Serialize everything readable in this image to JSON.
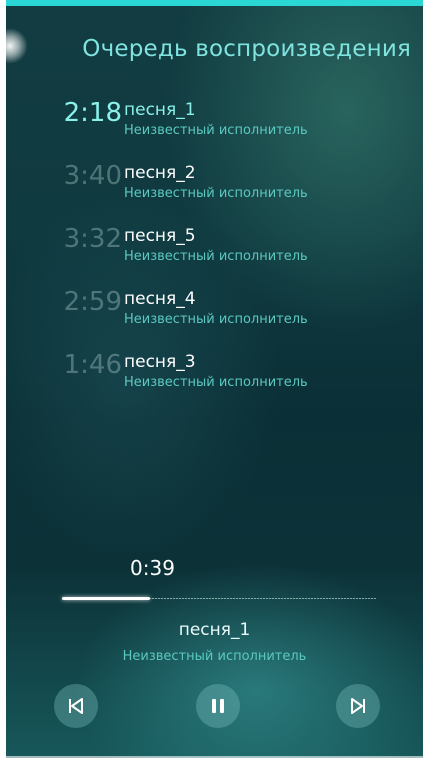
{
  "header": {
    "title": "Очередь воспроизведения"
  },
  "queue": [
    {
      "duration": "2:18",
      "title": "песня_1",
      "artist": "Неизвестный исполнитель",
      "active": true
    },
    {
      "duration": "3:40",
      "title": "песня_2",
      "artist": "Неизвестный исполнитель",
      "active": false
    },
    {
      "duration": "3:32",
      "title": "песня_5",
      "artist": "Неизвестный исполнитель",
      "active": false
    },
    {
      "duration": "2:59",
      "title": "песня_4",
      "artist": "Неизвестный исполнитель",
      "active": false
    },
    {
      "duration": "1:46",
      "title": "песня_3",
      "artist": "Неизвестный исполнитель",
      "active": false
    }
  ],
  "player": {
    "elapsed": "0:39",
    "progress_fraction": 0.28,
    "title": "песня_1",
    "artist": "Неизвестный исполнитель",
    "controls": {
      "prev_icon": "skip-previous-icon",
      "pause_icon": "pause-icon",
      "next_icon": "skip-next-icon"
    }
  },
  "colors": {
    "accent": "#2ad7d5",
    "highlight": "#8af0ea",
    "secondary_text": "#5bc9c1"
  }
}
